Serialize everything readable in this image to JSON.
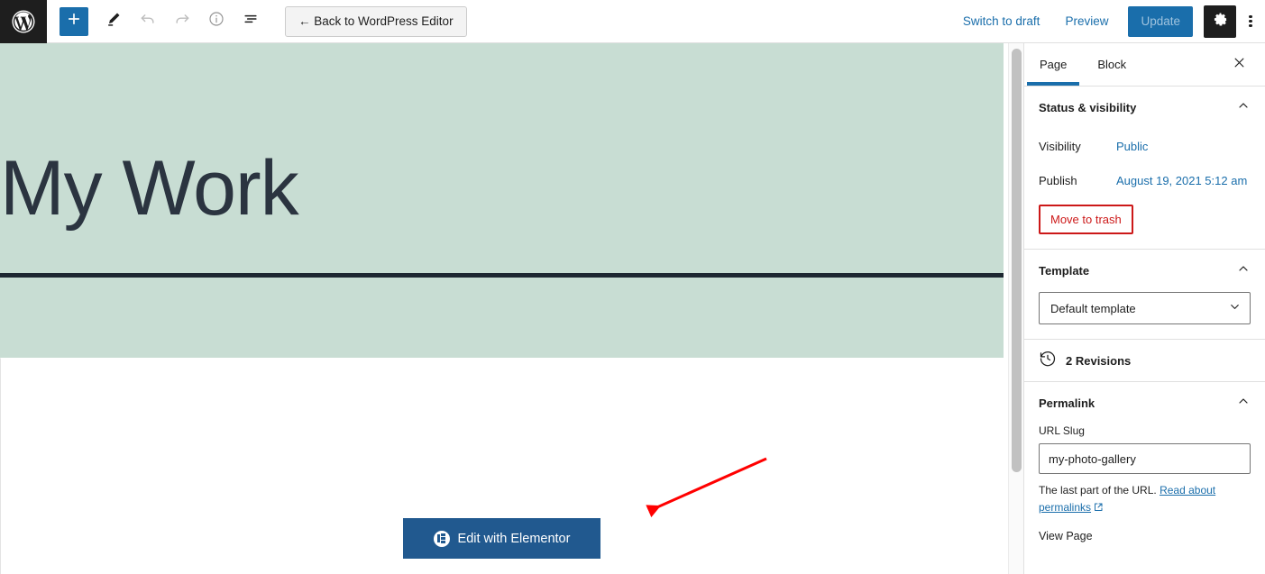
{
  "toolbar": {
    "wp_logo": "wordpress-logo",
    "add_block_label": "+",
    "tools": [
      {
        "name": "edit-tool",
        "title": "Tools"
      },
      {
        "name": "undo",
        "title": "Undo"
      },
      {
        "name": "redo",
        "title": "Redo"
      },
      {
        "name": "details",
        "title": "Details"
      },
      {
        "name": "list-view",
        "title": "List view"
      }
    ],
    "back_label": "← Back to WordPress Editor",
    "switch_to_draft_label": "Switch to draft",
    "preview_label": "Preview",
    "update_label": "Update",
    "settings_icon": "gear-icon",
    "more_icon": "ellipsis-vertical-icon"
  },
  "canvas": {
    "page_title": "My Work",
    "hero_bg": "#c8ddd3",
    "hero_rule_color": "#1d2731",
    "title_color": "#2b3440",
    "elementor_button_label": "Edit with Elementor",
    "elementor_button_color": "#21598f",
    "annotation_arrow_color": "#ff0000"
  },
  "sidebar": {
    "tabs": [
      {
        "label": "Page",
        "active": true
      },
      {
        "label": "Block",
        "active": false
      }
    ],
    "close_label": "Close settings",
    "status_visibility": {
      "title": "Status & visibility",
      "visibility_label": "Visibility",
      "visibility_value": "Public",
      "publish_label": "Publish",
      "publish_value": "August 19, 2021 5:12 am",
      "trash_label": "Move to trash",
      "trash_color": "#cc1818"
    },
    "template": {
      "title": "Template",
      "selected": "Default template"
    },
    "revisions": {
      "label": "2 Revisions",
      "icon": "history-icon"
    },
    "permalink": {
      "title": "Permalink",
      "url_slug_label": "URL Slug",
      "url_slug_value": "my-photo-gallery",
      "help_prefix": "The last part of the URL.",
      "help_link": "Read about permalinks",
      "view_page_label": "View Page"
    }
  }
}
